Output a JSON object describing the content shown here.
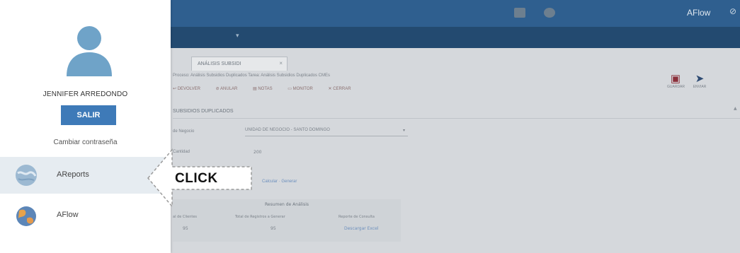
{
  "topbar": {
    "brand": "AFlow",
    "close_glyph": "⊘"
  },
  "tab": {
    "label": "ANÁLISIS SUBSIDI",
    "close_glyph": "×"
  },
  "process_line": "Proceso: Análisis Subsidios Duplicados Tarea: Análisis Subsidios Duplicados CMEs",
  "toolbar": {
    "devolver": "DEVOLVER",
    "anular": "ANULAR",
    "notas": "NOTAS",
    "monitor": "MONITOR",
    "cerrar": "CERRAR",
    "save_label": "GUARDAR",
    "send_label": "ENVIAR"
  },
  "section": {
    "title": "SUBSIDIOS DUPLICADOS"
  },
  "form": {
    "business_label": "de Negocio",
    "business_value": "UNIDAD DE NEGOCIO - SANTO DOMINGO",
    "quantity_label": "Cantidad",
    "quantity_value": "200",
    "generate_link": "Calcular · Generar"
  },
  "summary": {
    "title": "Resumen de Análisis",
    "headers": [
      "al de Clientes",
      "Total de Registros a Generar",
      "Reporte de Consulta"
    ],
    "values": [
      "95",
      "95"
    ],
    "download_link": "Descargar Excel"
  },
  "sidebar": {
    "user_name": "JENNIFER ARREDONDO",
    "logout_label": "SALIR",
    "change_password": "Cambiar contraseña",
    "items": [
      {
        "label": "AReports",
        "icon": "globe-icon"
      },
      {
        "label": "AFlow",
        "icon": "globe-icon"
      }
    ]
  },
  "callout": {
    "text": "CLICK"
  },
  "colors": {
    "topbar": "#2f5f8f",
    "subbar": "#234a70",
    "button": "#3e7ab8",
    "avatar": "#6fa3c8",
    "active_item": "#e6ecf1"
  }
}
